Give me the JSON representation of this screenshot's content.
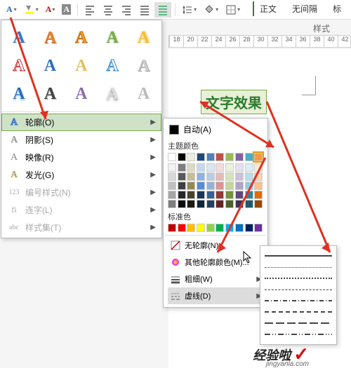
{
  "toolbar": {
    "text_effects_btn": "A",
    "styles": {
      "normal": "正文",
      "no_spacing": "无间隔",
      "heading_prefix": "标"
    },
    "styles_group_label": "样式"
  },
  "ruler": {
    "ticks": [
      "18",
      "20",
      "22",
      "24",
      "26",
      "28",
      "30",
      "32",
      "34",
      "36",
      "38",
      "40",
      "42"
    ]
  },
  "sample_text": "文字效果",
  "effects_dropdown": {
    "grid_glyph": "A",
    "menu": {
      "outline": {
        "label": "轮廓(O)",
        "icon": "A"
      },
      "shadow": {
        "label": "阴影(S)",
        "icon": "A"
      },
      "reflection": {
        "label": "映像(R)",
        "icon": "A"
      },
      "glow": {
        "label": "发光(G)",
        "icon": "A"
      },
      "number_style": {
        "label": "编号样式(N)",
        "icon": "123"
      },
      "ligatures": {
        "label": "连字(L)",
        "icon": "fi"
      },
      "stylistic_sets": {
        "label": "样式集(T)",
        "icon": "abc"
      }
    }
  },
  "color_submenu": {
    "auto": "自动(A)",
    "theme_label": "主题颜色",
    "theme_row1": [
      "#ffffff",
      "#000000",
      "#eeece1",
      "#1f497d",
      "#4f81bd",
      "#c0504d",
      "#9bbb59",
      "#8064a2",
      "#4bacc6",
      "#f79646"
    ],
    "theme_shades": [
      [
        "#f2f2f2",
        "#7f7f7f",
        "#ddd9c3",
        "#c6d9f0",
        "#dbe5f1",
        "#f2dcdb",
        "#ebf1dd",
        "#e5e0ec",
        "#dbeef3",
        "#fdeada"
      ],
      [
        "#d8d8d8",
        "#595959",
        "#c4bd97",
        "#8db3e2",
        "#b8cce4",
        "#e5b9b7",
        "#d7e3bc",
        "#ccc1d9",
        "#b7dde8",
        "#fbd5b5"
      ],
      [
        "#bfbfbf",
        "#3f3f3f",
        "#938953",
        "#548dd4",
        "#95b3d7",
        "#d99694",
        "#c3d69b",
        "#b2a2c7",
        "#92cddc",
        "#fac08f"
      ],
      [
        "#a5a5a5",
        "#262626",
        "#494429",
        "#17365d",
        "#366092",
        "#953734",
        "#76923c",
        "#5f497a",
        "#31859b",
        "#e36c09"
      ],
      [
        "#7f7f7f",
        "#0c0c0c",
        "#1d1b10",
        "#0f243e",
        "#244061",
        "#632423",
        "#4f6128",
        "#3f3151",
        "#205867",
        "#974806"
      ]
    ],
    "standard_label": "标准色",
    "standard": [
      "#c00000",
      "#ff0000",
      "#ffc000",
      "#ffff00",
      "#92d050",
      "#00b050",
      "#00b0f0",
      "#0070c0",
      "#002060",
      "#7030a0"
    ],
    "no_outline": "无轮廓(N)",
    "more_colors": "其他轮廓颜色(M)...",
    "weight": "粗细(W)",
    "dashes": "虚线(D)"
  },
  "dash_flyout": {
    "styles": [
      "solid",
      "dotted-fine",
      "dotted",
      "dashed-short",
      "dash-dot",
      "dashed",
      "dashed-long",
      "dash-dot-dot"
    ]
  },
  "watermark": {
    "brand": "经验啦",
    "url": "jingyanla.com",
    "check": "✓"
  }
}
